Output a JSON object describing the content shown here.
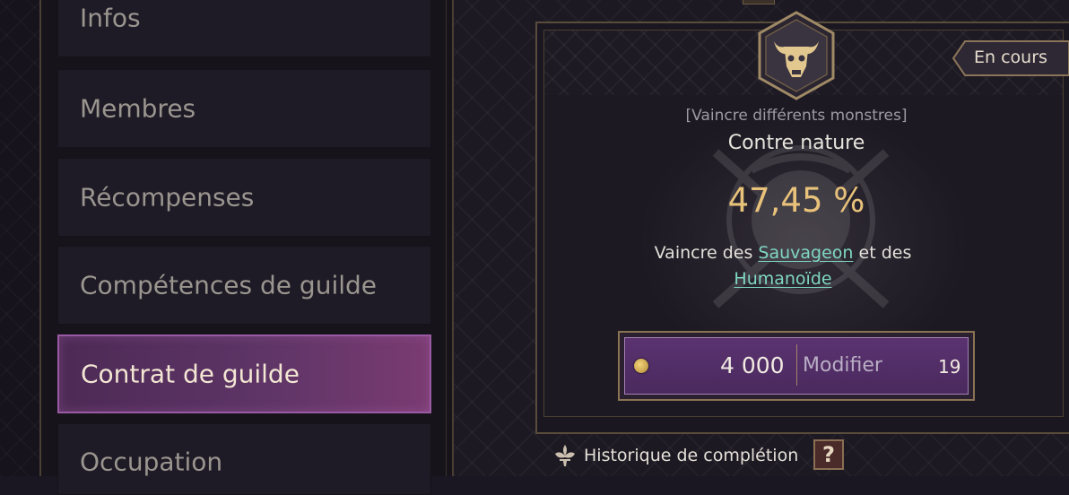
{
  "sidebar": {
    "items": [
      {
        "label": "Infos"
      },
      {
        "label": "Membres"
      },
      {
        "label": "Récompenses"
      },
      {
        "label": "Compétences de guilde"
      },
      {
        "label": "Contrat de guilde",
        "active": true
      },
      {
        "label": "Occupation"
      }
    ]
  },
  "contract": {
    "status": "En cours",
    "category": "[Vaincre différents monstres]",
    "name": "Contre nature",
    "progress": "47,45 %",
    "description_prefix": "Vaincre des",
    "monster_1": "Sauvageon",
    "description_middle": "et des",
    "monster_2": "Humanoïde"
  },
  "action": {
    "cost": "4 000",
    "label": "Modifier",
    "count": "19"
  },
  "footer": {
    "history_label": "Historique de complétion",
    "help_symbol": "?"
  },
  "colors": {
    "accent_gold": "#e8c27a",
    "link_teal": "#7fd7c4",
    "active_purple": "#5e3566"
  },
  "icons": [
    "bull-skull-emblem-icon",
    "coin-icon",
    "fleur-de-lis-icon",
    "question-icon"
  ]
}
